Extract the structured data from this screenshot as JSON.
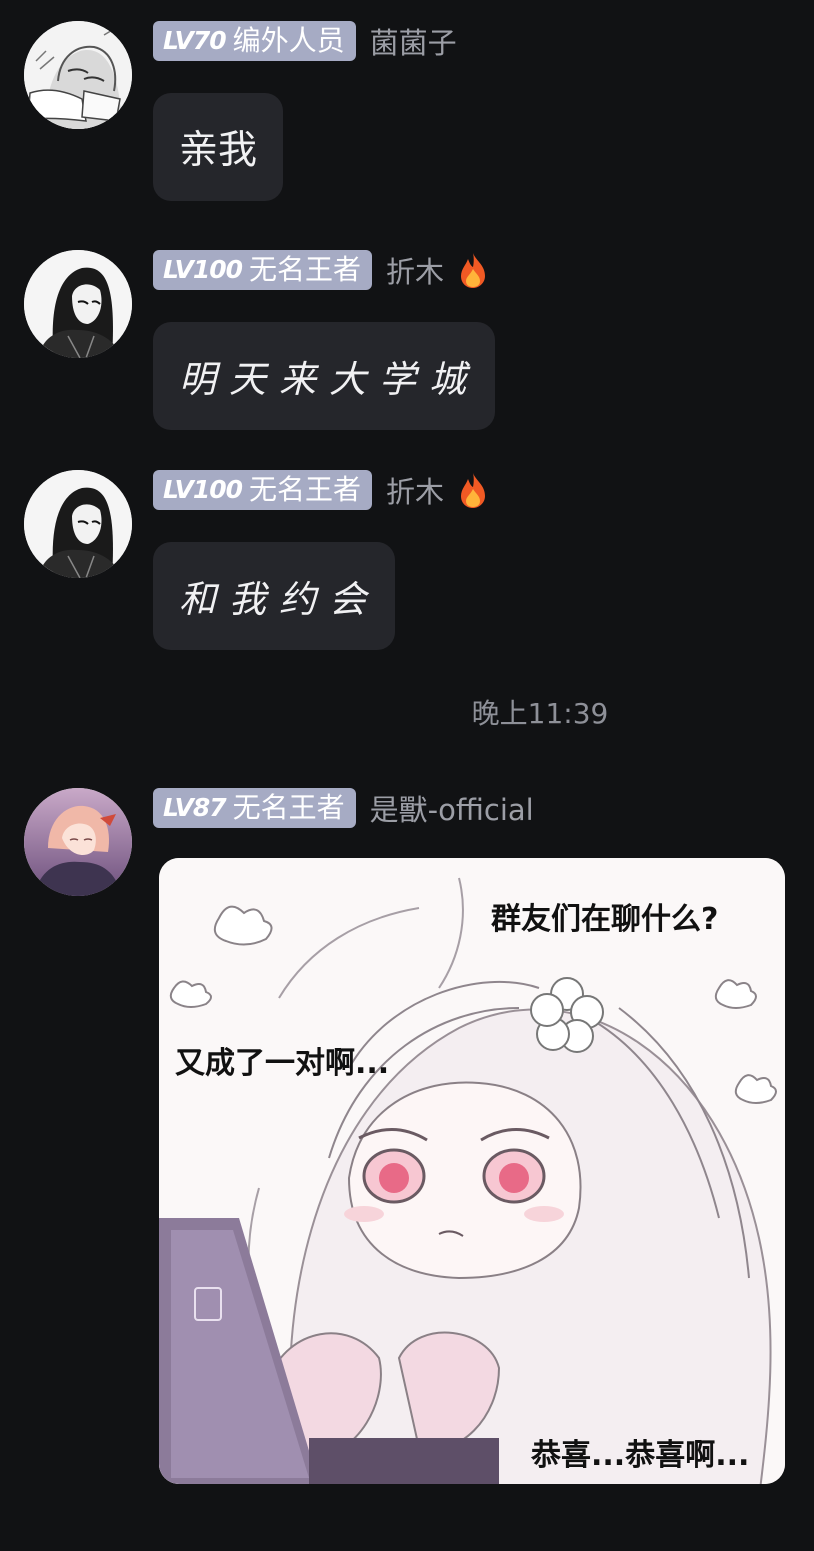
{
  "messages": [
    {
      "level": "LV70",
      "title": "编外人员",
      "username": "菌菌子",
      "text": "亲我",
      "avatar": "manga-girl-avatar",
      "fire": false
    },
    {
      "level": "LV100",
      "title": "无名王者",
      "username": "折木",
      "text": "明天来大学城",
      "avatar": "dark-hair-girl-avatar",
      "fire": true
    },
    {
      "level": "LV100",
      "title": "无名王者",
      "username": "折木",
      "text": "和我约会",
      "avatar": "dark-hair-girl-avatar",
      "fire": true
    },
    {
      "level": "LV87",
      "title": "无名王者",
      "username": "是獸-official",
      "avatar": "pink-hair-girl-avatar",
      "sticker": {
        "caption_top": "群友们在聊什么?",
        "caption_left": "又成了一对啊...",
        "caption_bottom": "恭喜...恭喜啊..."
      }
    }
  ],
  "timestamp": "晚上11:39",
  "colors": {
    "background": "#111214",
    "bubble": "#25262b",
    "badge": "#a6abc4",
    "username": "#9c9ea6"
  }
}
